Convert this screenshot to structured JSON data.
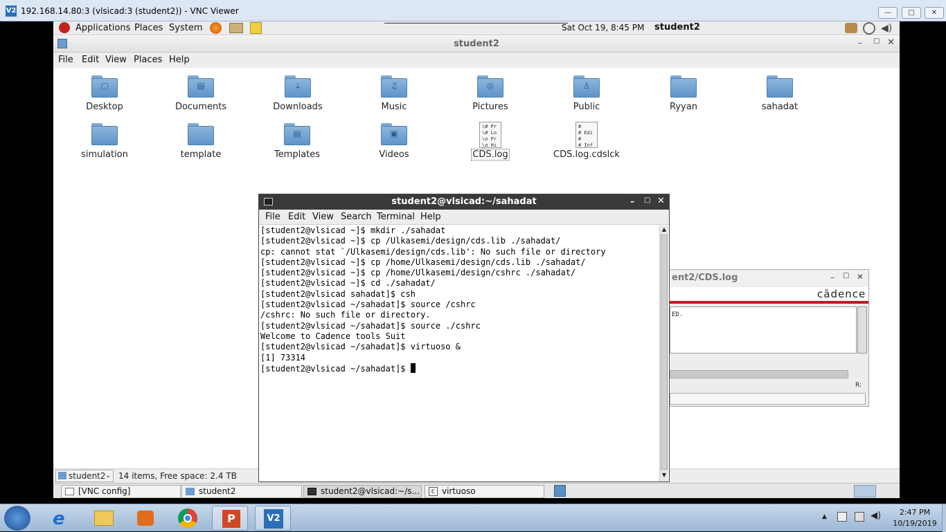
{
  "vnc": {
    "title": "192.168.14.80:3 (vlsicad:3 (student2)) - VNC Viewer",
    "logo": "V2"
  },
  "gnome_panel": {
    "menus": [
      "Applications",
      "Places",
      "System"
    ],
    "clock": "Sat Oct 19,  8:45 PM",
    "user": "student2"
  },
  "nautilus": {
    "title": "student2",
    "menu": [
      "File",
      "Edit",
      "View",
      "Places",
      "Help"
    ],
    "items": [
      {
        "label": "Desktop",
        "icon": "desktop-folder-icon"
      },
      {
        "label": "Documents",
        "icon": "documents-folder-icon"
      },
      {
        "label": "Downloads",
        "icon": "downloads-folder-icon"
      },
      {
        "label": "Music",
        "icon": "music-folder-icon"
      },
      {
        "label": "Pictures",
        "icon": "pictures-folder-icon"
      },
      {
        "label": "Public",
        "icon": "public-folder-icon"
      },
      {
        "label": "Ryyan",
        "icon": "folder-icon"
      },
      {
        "label": "sahadat",
        "icon": "folder-icon"
      },
      {
        "label": "simulation",
        "icon": "folder-icon"
      },
      {
        "label": "template",
        "icon": "folder-icon"
      },
      {
        "label": "Templates",
        "icon": "templates-folder-icon"
      },
      {
        "label": "Videos",
        "icon": "videos-folder-icon"
      },
      {
        "label": "CDS.log",
        "icon": "text-file-icon",
        "preview": "\\# Pr\n\\# Lo\n\\o Pr\n\\o Hi"
      },
      {
        "label": "CDS.log.cdslck",
        "icon": "text-file-icon",
        "preview": "#\n# Edi\n#\n# Inf"
      }
    ],
    "location": "student2",
    "status": "14 items, Free space: 2.4 TB"
  },
  "gnome_taskbar": {
    "buttons": [
      "[VNC config]",
      "student2",
      "student2@vlsicad:~/s...",
      "virtuoso"
    ]
  },
  "cadence_window": {
    "title": "ent2/CDS.log",
    "brand": "cādence",
    "text": "ED.",
    "label_r": "R:"
  },
  "terminal": {
    "title": "student2@vlsicad:~/sahadat",
    "menu": [
      "File",
      "Edit",
      "View",
      "Search",
      "Terminal",
      "Help"
    ],
    "lines": [
      "[student2@vlsicad ~]$ mkdir ./sahadat",
      "[student2@vlsicad ~]$ cp /Ulkasemi/design/cds.lib ./sahadat/",
      "cp: cannot stat `/Ulkasemi/design/cds.lib': No such file or directory",
      "[student2@vlsicad ~]$ cp /home/Ulkasemi/design/cds.lib ./sahadat/",
      "[student2@vlsicad ~]$ cp /home/Ulkasemi/design/cshrc ./sahadat/",
      "[student2@vlsicad ~]$ cd ./sahadat/",
      "[student2@vlsicad sahadat]$ csh",
      "[student2@vlsicad ~/sahadat]$ source /cshrc",
      "/cshrc: No such file or directory.",
      "[student2@vlsicad ~/sahadat]$ source ./cshrc",
      "Welcome to Cadence tools Suit",
      "[student2@vlsicad ~/sahadat]$ virtuoso &",
      "[1] 73314",
      "[student2@vlsicad ~/sahadat]$ "
    ]
  },
  "windows_tray": {
    "time": "2:47 PM",
    "date": "10/19/2019"
  }
}
